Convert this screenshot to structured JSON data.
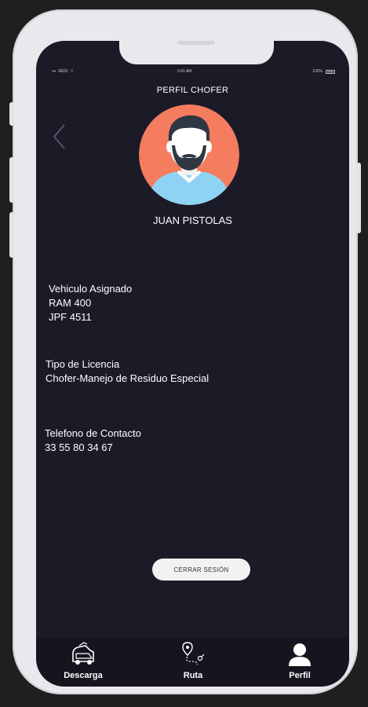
{
  "status_bar": {
    "carrier": "REDI",
    "time": "9:41 AM",
    "battery": "100%"
  },
  "header": {
    "title": "PERFIL CHOFER"
  },
  "profile": {
    "name": "JUAN PISTOLAS"
  },
  "vehicle": {
    "label": "Vehiculo Asignado",
    "model": "RAM 400",
    "plate": "JPF 4511"
  },
  "license": {
    "label": "Tipo de Licencia",
    "value": "Chofer-Manejo de Residuo Especial"
  },
  "contact": {
    "label": "Telefono de Contacto",
    "value": "33 55 80 34 67"
  },
  "logout": {
    "label": "CERRAR SESIÓN"
  },
  "tabs": [
    {
      "label": "Descarga",
      "icon": "truck-icon"
    },
    {
      "label": "Ruta",
      "icon": "route-icon"
    },
    {
      "label": "Perfil",
      "icon": "user-icon"
    }
  ],
  "colors": {
    "screen_bg": "#1b1b28",
    "avatar_bg": "#f47c5f",
    "shirt": "#8fd3f4",
    "hair": "#2f3842"
  }
}
